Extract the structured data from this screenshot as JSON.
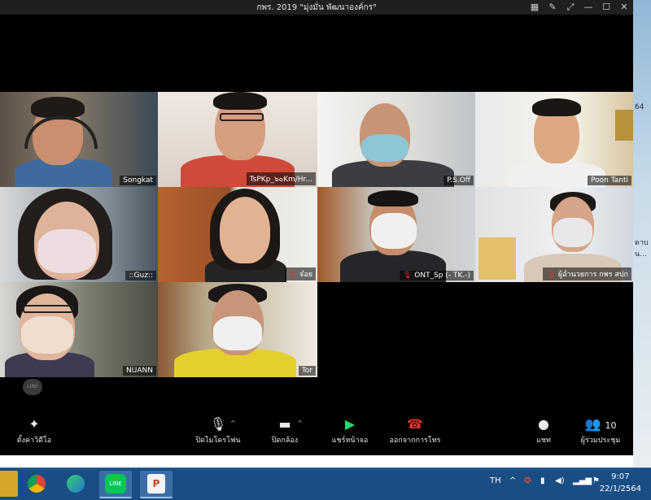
{
  "window": {
    "title": "กพร. 2019 \"มุ่งมั่น พัฒนาองค์กร\""
  },
  "participants": [
    {
      "name": "Songkat"
    },
    {
      "name": "TsPKp_๖๐Km/Hr..."
    },
    {
      "name": "P.S.Off"
    },
    {
      "name": "Poon Tanti"
    },
    {
      "name": "::Guz::"
    },
    {
      "name": "จ๋อย"
    },
    {
      "name": "ONT_Sp (- TK.-)"
    },
    {
      "name": "ผู้อำนวยการ กพร สปก"
    },
    {
      "name": "NUANN"
    },
    {
      "name": "Tor"
    }
  ],
  "toolbar": {
    "video_settings": "ตั้งค่าวิดีโอ",
    "mute": "ปิดไมโครโฟน",
    "stop_video": "ปิดกล้อง",
    "share_screen": "แชร์หน้าจอ",
    "leave": "ออกจากการโทร",
    "chat": "แชท",
    "participants": "ผู้ร่วมประชุม",
    "participant_count": "10"
  },
  "desktop": {
    "side_text_1": "64",
    "side_text_2": "ดาบ",
    "side_text_3": "น..."
  },
  "taskbar": {
    "language": "TH",
    "time": "9:07",
    "date": "22/1/2564",
    "line_label": "LINE"
  },
  "colors": {
    "active_speaker": "#23d96b",
    "leave_red": "#e0322a",
    "share_green": "#23d96b",
    "taskbar": "#1a4d84"
  }
}
